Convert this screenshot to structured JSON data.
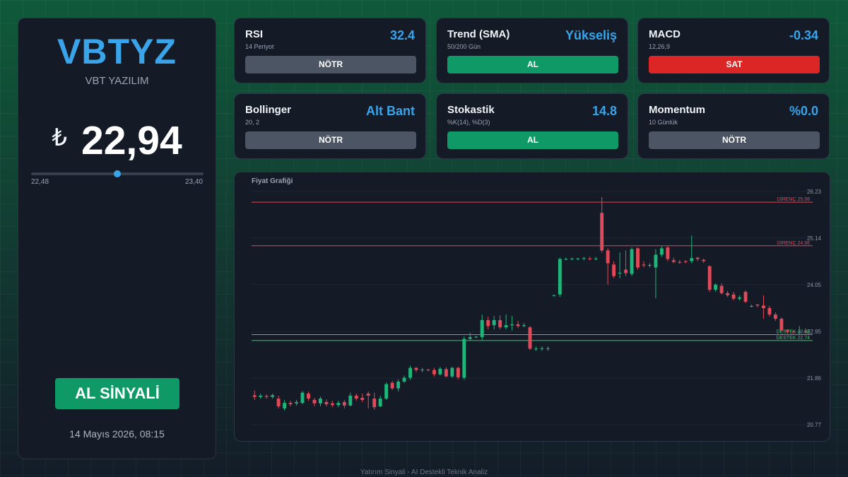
{
  "stock": {
    "ticker": "VBTYZ",
    "company": "VBT YAZILIM",
    "currency_symbol": "₺",
    "price": "22,94",
    "range_low": "22,48",
    "range_high": "23,40",
    "range_position": 0.5,
    "signal": "AL SİNYALİ",
    "timestamp": "14 Mayıs 2026, 08:15"
  },
  "indicators": [
    {
      "title": "RSI",
      "subtitle": "14 Periyot",
      "value": "32.4",
      "signal": "NÖTR",
      "signal_type": "neutral"
    },
    {
      "title": "Trend (SMA)",
      "subtitle": "50/200 Gün",
      "value": "Yükseliş",
      "signal": "AL",
      "signal_type": "buy"
    },
    {
      "title": "MACD",
      "subtitle": "12,26,9",
      "value": "-0.34",
      "signal": "SAT",
      "signal_type": "sell"
    },
    {
      "title": "Bollinger",
      "subtitle": "20, 2",
      "value": "Alt Bant",
      "signal": "NÖTR",
      "signal_type": "neutral"
    },
    {
      "title": "Stokastik",
      "subtitle": "%K(14), %D(3)",
      "value": "14.8",
      "signal": "AL",
      "signal_type": "buy"
    },
    {
      "title": "Momentum",
      "subtitle": "10 Günlük",
      "value": "%0.0",
      "signal": "NÖTR",
      "signal_type": "neutral"
    }
  ],
  "chart": {
    "title": "Fiyat Grafiği",
    "y_ticks": [
      "26.23",
      "25.14",
      "24.05",
      "22.95",
      "21.86",
      "20.77"
    ]
  },
  "chart_data": {
    "type": "candlestick",
    "title": "Fiyat Grafiği",
    "ylim": [
      20.77,
      26.23
    ],
    "y_ticks": [
      26.23,
      25.14,
      24.05,
      22.95,
      21.86,
      20.77
    ],
    "levels": [
      {
        "label": "DİRENÇ 25.98",
        "value": 25.98,
        "kind": "resistance"
      },
      {
        "label": "DİRENÇ 24.96",
        "value": 24.96,
        "kind": "resistance"
      },
      {
        "label": "DESTEK 22.88",
        "value": 22.88,
        "kind": "support"
      },
      {
        "label": "DESTEK 22.74",
        "value": 22.74,
        "kind": "support"
      }
    ],
    "candles": [
      [
        21.46,
        21.42,
        21.57,
        21.35
      ],
      [
        21.42,
        21.45,
        21.5,
        21.38
      ],
      [
        21.44,
        21.42,
        21.48,
        21.38
      ],
      [
        21.42,
        21.46,
        21.5,
        21.38
      ],
      [
        21.38,
        21.2,
        21.45,
        21.15
      ],
      [
        21.15,
        21.28,
        21.35,
        21.1
      ],
      [
        21.28,
        21.25,
        21.33,
        21.2
      ],
      [
        21.27,
        21.3,
        21.35,
        21.22
      ],
      [
        21.28,
        21.52,
        21.56,
        21.25
      ],
      [
        21.5,
        21.38,
        21.55,
        21.33
      ],
      [
        21.35,
        21.27,
        21.4,
        21.2
      ],
      [
        21.27,
        21.38,
        21.43,
        21.2
      ],
      [
        21.3,
        21.25,
        21.36,
        21.2
      ],
      [
        21.27,
        21.23,
        21.33,
        21.18
      ],
      [
        21.23,
        21.28,
        21.33,
        21.18
      ],
      [
        21.3,
        21.22,
        21.35,
        21.15
      ],
      [
        21.22,
        21.45,
        21.52,
        21.2
      ],
      [
        21.45,
        21.38,
        21.5,
        21.33
      ],
      [
        21.4,
        21.35,
        21.5,
        21.3
      ],
      [
        21.5,
        21.45,
        21.55,
        21.15
      ],
      [
        21.38,
        21.18,
        21.52,
        21.12
      ],
      [
        21.2,
        21.38,
        21.45,
        21.18
      ],
      [
        21.38,
        21.72,
        21.76,
        21.35
      ],
      [
        21.75,
        21.62,
        21.8,
        21.58
      ],
      [
        21.62,
        21.78,
        21.83,
        21.55
      ],
      [
        21.78,
        21.87,
        21.92,
        21.75
      ],
      [
        21.87,
        22.1,
        22.15,
        21.82
      ],
      [
        22.1,
        22.05,
        22.12,
        22.0
      ],
      [
        22.05,
        22.06,
        22.1,
        22.0
      ],
      [
        22.06,
        22.05,
        22.08,
        22.02
      ],
      [
        22.05,
        21.95,
        22.1,
        21.9
      ],
      [
        21.95,
        22.08,
        22.12,
        21.92
      ],
      [
        22.07,
        21.9,
        22.12,
        21.88
      ],
      [
        21.9,
        22.1,
        22.13,
        21.87
      ],
      [
        22.1,
        21.88,
        22.13,
        21.83
      ],
      [
        21.87,
        22.78,
        22.84,
        21.82
      ],
      [
        22.78,
        22.82,
        22.92,
        22.75
      ],
      [
        22.82,
        22.83,
        22.85,
        22.8
      ],
      [
        22.82,
        23.22,
        23.35,
        22.75
      ],
      [
        23.22,
        23.08,
        23.3,
        23.0
      ],
      [
        23.1,
        23.22,
        23.32,
        23.0
      ],
      [
        23.22,
        23.05,
        23.33,
        23.0
      ],
      [
        23.05,
        23.1,
        23.35,
        23.0
      ],
      [
        23.1,
        23.12,
        23.32,
        22.98
      ],
      [
        23.12,
        23.08,
        23.2,
        23.03
      ],
      [
        23.08,
        23.1,
        23.15,
        23.05
      ],
      [
        23.05,
        22.55,
        23.08,
        22.52
      ],
      [
        22.55,
        22.55,
        22.6,
        22.5
      ],
      [
        22.55,
        22.56,
        22.6,
        22.5
      ],
      [
        22.55,
        22.56,
        22.6,
        22.5
      ],
      [
        23.8,
        23.8,
        23.82,
        23.77
      ],
      [
        23.82,
        24.65,
        24.68,
        23.76
      ],
      [
        24.65,
        24.65,
        24.68,
        24.62
      ],
      [
        24.65,
        24.66,
        24.68,
        24.62
      ],
      [
        24.65,
        24.66,
        24.68,
        24.62
      ],
      [
        24.66,
        24.67,
        24.7,
        24.62
      ],
      [
        24.66,
        24.65,
        24.7,
        24.62
      ],
      [
        24.66,
        24.66,
        24.7,
        24.62
      ],
      [
        25.73,
        24.85,
        26.1,
        24.8
      ],
      [
        24.85,
        24.55,
        24.9,
        24.05
      ],
      [
        24.52,
        24.25,
        24.6,
        24.2
      ],
      [
        24.32,
        24.33,
        24.8,
        24.2
      ],
      [
        24.4,
        24.32,
        24.85,
        24.25
      ],
      [
        24.3,
        24.88,
        24.92,
        24.25
      ],
      [
        24.9,
        24.45,
        24.92,
        24.4
      ],
      [
        24.52,
        24.5,
        24.6,
        24.45
      ],
      [
        24.5,
        24.51,
        24.55,
        24.45
      ],
      [
        24.45,
        24.75,
        24.88,
        23.73
      ],
      [
        24.75,
        24.9,
        24.95,
        24.7
      ],
      [
        24.92,
        24.65,
        24.95,
        24.6
      ],
      [
        24.62,
        24.58,
        24.68,
        24.55
      ],
      [
        24.58,
        24.57,
        24.63,
        24.53
      ],
      [
        24.6,
        24.58,
        24.62,
        24.55
      ],
      [
        24.6,
        24.67,
        25.2,
        24.55
      ],
      [
        24.68,
        24.65,
        24.7,
        24.6
      ],
      [
        24.63,
        24.6,
        24.66,
        24.56
      ],
      [
        24.48,
        23.93,
        24.5,
        23.88
      ],
      [
        23.93,
        24.05,
        24.08,
        23.88
      ],
      [
        24.02,
        23.85,
        24.08,
        23.82
      ],
      [
        23.85,
        23.8,
        23.9,
        23.76
      ],
      [
        23.82,
        23.72,
        23.88,
        23.68
      ],
      [
        23.72,
        23.75,
        23.8,
        23.68
      ],
      [
        23.88,
        23.65,
        23.92,
        23.62
      ],
      [
        23.55,
        23.55,
        23.58,
        23.52
      ],
      [
        23.58,
        23.56,
        23.6,
        23.52
      ],
      [
        23.56,
        23.5,
        23.8,
        23.25
      ],
      [
        23.5,
        23.35,
        23.55,
        23.3
      ],
      [
        23.35,
        23.25,
        23.4,
        23.2
      ],
      [
        23.25,
        22.98,
        23.28,
        22.95
      ],
      [
        22.98,
        22.95,
        23.0,
        22.9
      ],
      [
        22.95,
        22.94,
        22.98,
        22.9
      ],
      [
        22.94,
        22.95,
        23.08,
        22.88
      ],
      [
        22.95,
        22.94,
        23.02,
        22.9
      ]
    ]
  },
  "footer": "Yatırım Sinyali - AI Destekli Teknik Analiz"
}
